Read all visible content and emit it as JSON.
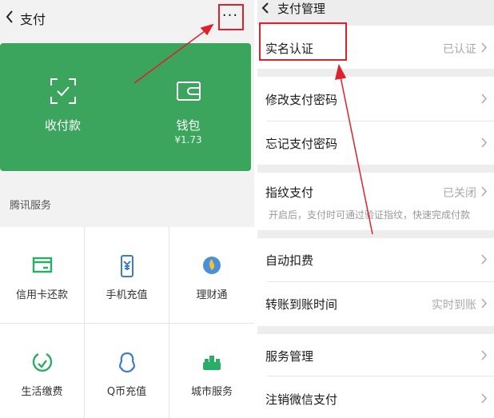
{
  "left": {
    "header": {
      "title": "支付",
      "back_icon": "chevron-left-icon",
      "more_label": "···"
    },
    "card": {
      "background": "#3ba55d",
      "receive": {
        "label": "收付款",
        "icon": "scan-qr-icon"
      },
      "wallet": {
        "label": "钱包",
        "balance": "¥1.73",
        "icon": "wallet-icon"
      }
    },
    "section_title": "腾讯服务",
    "services": [
      {
        "label": "信用卡还款",
        "icon": "credit-card-icon"
      },
      {
        "label": "手机充值",
        "icon": "phone-recharge-icon"
      },
      {
        "label": "理财通",
        "icon": "wealth-icon"
      },
      {
        "label": "生活缴费",
        "icon": "life-payment-icon"
      },
      {
        "label": "Q币充值",
        "icon": "qcoin-icon"
      },
      {
        "label": "城市服务",
        "icon": "city-service-icon"
      }
    ]
  },
  "right": {
    "header": {
      "title": "支付管理",
      "back_icon": "chevron-left-icon"
    },
    "rows": {
      "realname": {
        "label": "实名认证",
        "value": "已认证"
      },
      "change_pwd": {
        "label": "修改支付密码"
      },
      "forgot_pwd": {
        "label": "忘记支付密码"
      },
      "fingerprint": {
        "label": "指纹支付",
        "value": "已关闭",
        "description": "开启后，支付时可通过验证指纹，快速完成付款"
      },
      "auto_deduct": {
        "label": "自动扣费"
      },
      "transfer_time": {
        "label": "转账到账时间",
        "value": "实时到账"
      },
      "service_mgmt": {
        "label": "服务管理"
      },
      "cancel_pay": {
        "label": "注销微信支付"
      }
    }
  },
  "annotation_color": "#e0202a",
  "accent_green": "#2aae67"
}
